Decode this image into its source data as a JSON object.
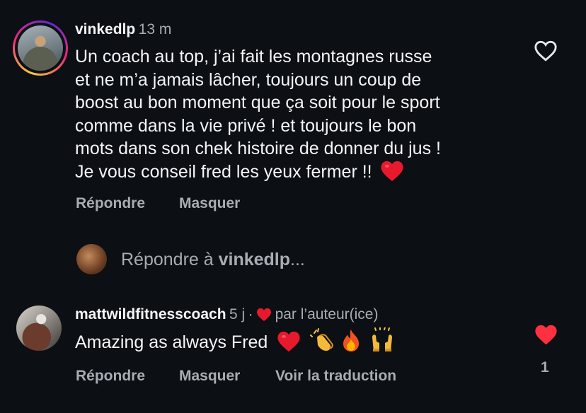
{
  "comment": {
    "username": "vinkedlp",
    "time": "13 m",
    "lines": [
      "Un coach au top, j’ai fait les montagnes russe",
      "et ne m’a jamais lâcher, toujours un coup de",
      "boost au bon moment que ça soit pour le sport",
      "comme dans la vie privé ! et toujours le bon",
      "mots dans son chek histoire de donner du jus !",
      "Je vous conseil fred les yeux fermer !!"
    ],
    "actions": {
      "reply": "Répondre",
      "hide": "Masquer"
    }
  },
  "reply_field": {
    "prefix": "Répondre à ",
    "target": "vinkedlp",
    "suffix": "..."
  },
  "reply": {
    "username": "mattwildfitnesscoach",
    "time": "5 j",
    "separator": "·",
    "author_badge": "par l’auteur(ice)",
    "text": "Amazing as always Fred",
    "actions": {
      "reply": "Répondre",
      "hide": "Masquer",
      "translate": "Voir la traduction"
    },
    "like_count": "1"
  },
  "colors": {
    "background": "#0c0f14",
    "heart_red": "#e8192c",
    "muted_text": "#a8adb3",
    "primary_text": "#f3f5f7"
  },
  "icons": [
    "heart-outline-icon",
    "heart-filled-icon",
    "red-heart-emoji",
    "clapping-hands-emoji",
    "fire-emoji",
    "raising-hands-emoji"
  ]
}
